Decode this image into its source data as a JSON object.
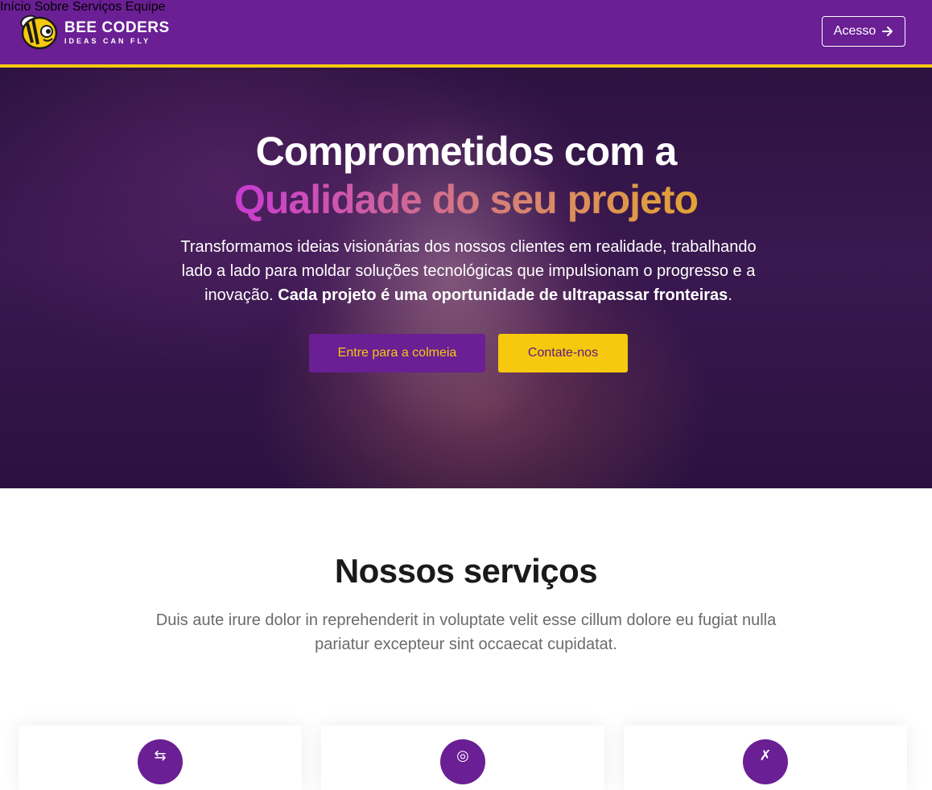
{
  "header": {
    "logo": {
      "title": "BEE CODERS",
      "subtitle": "IDEAS CAN FLY",
      "icon": "bee-icon"
    },
    "nav": [
      "Início",
      "Sobre",
      "Serviços",
      "Equipe"
    ],
    "login_label": "Acesso",
    "login_icon": "arrow-right-icon"
  },
  "hero": {
    "title_line1": "Comprometidos com a",
    "title_line2": "Qualidade do seu projeto",
    "description": "Transformamos ideias visionárias dos nossos clientes em realidade, trabalhando lado a lado para moldar soluções tecnológicas que impulsionam o progresso e a inovação.",
    "description_bold": "Cada projeto é uma oportunidade de ultrapassar fronteiras",
    "description_end": ".",
    "primary_button": "Entre para a colmeia",
    "secondary_button": "Contate-nos"
  },
  "services": {
    "title": "Nossos serviços",
    "description": "Duis aute irure dolor in reprehenderit in voluptate velit esse cillum dolore eu fugiat nulla pariatur excepteur sint occaecat cupidatat.",
    "cards": [
      {
        "icon": "shuffle-icon"
      },
      {
        "icon": "target-icon"
      },
      {
        "icon": "tools-icon"
      }
    ]
  },
  "colors": {
    "brand_purple": "#6a1f94",
    "brand_yellow": "#f6c90e"
  }
}
